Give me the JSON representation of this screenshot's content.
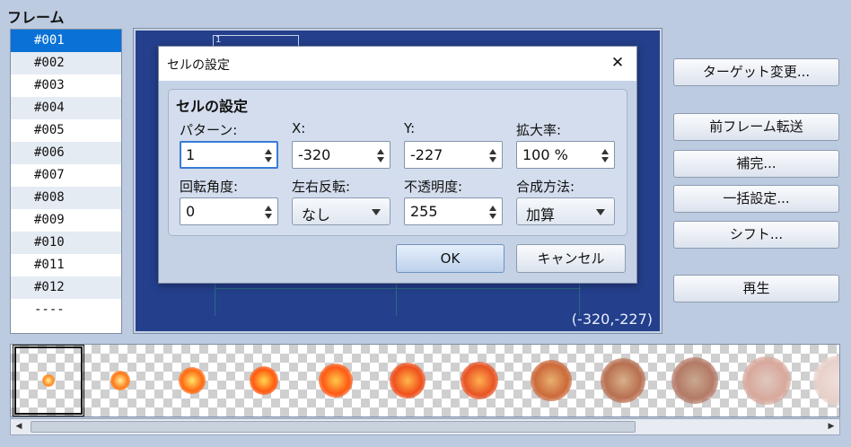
{
  "frame_panel": {
    "title": "フレーム",
    "frames": [
      "#001",
      "#002",
      "#003",
      "#004",
      "#005",
      "#006",
      "#007",
      "#008",
      "#009",
      "#010",
      "#011",
      "#012",
      "----"
    ],
    "selected_index": 0
  },
  "canvas": {
    "cell_number": "1",
    "coordinates": "(-320,-227)"
  },
  "right_buttons": {
    "change_target": "ターゲット変更...",
    "copy_prev_frame": "前フレーム転送",
    "interpolate": "補完...",
    "batch_settings": "一括設定...",
    "shift": "シフト...",
    "play": "再生"
  },
  "dialog": {
    "title": "セルの設定",
    "group_title": "セルの設定",
    "labels": {
      "pattern": "パターン:",
      "x": "X:",
      "y": "Y:",
      "zoom": "拡大率:",
      "rotation": "回転角度:",
      "mirror": "左右反転:",
      "opacity": "不透明度:",
      "blend": "合成方法:"
    },
    "values": {
      "pattern": "1",
      "x": "-320",
      "y": "-227",
      "zoom": "100 %",
      "rotation": "0",
      "mirror": "なし",
      "opacity": "255",
      "blend": "加算"
    },
    "ok": "OK",
    "cancel": "キャンセル"
  },
  "filmstrip": {
    "frame_count": 12,
    "selected_index": 0
  },
  "colors": {
    "selection": "#0a72d6",
    "canvas_bg": "#243f8b",
    "window_bg": "#bccbe0",
    "focus_border": "#3a7bd5"
  }
}
